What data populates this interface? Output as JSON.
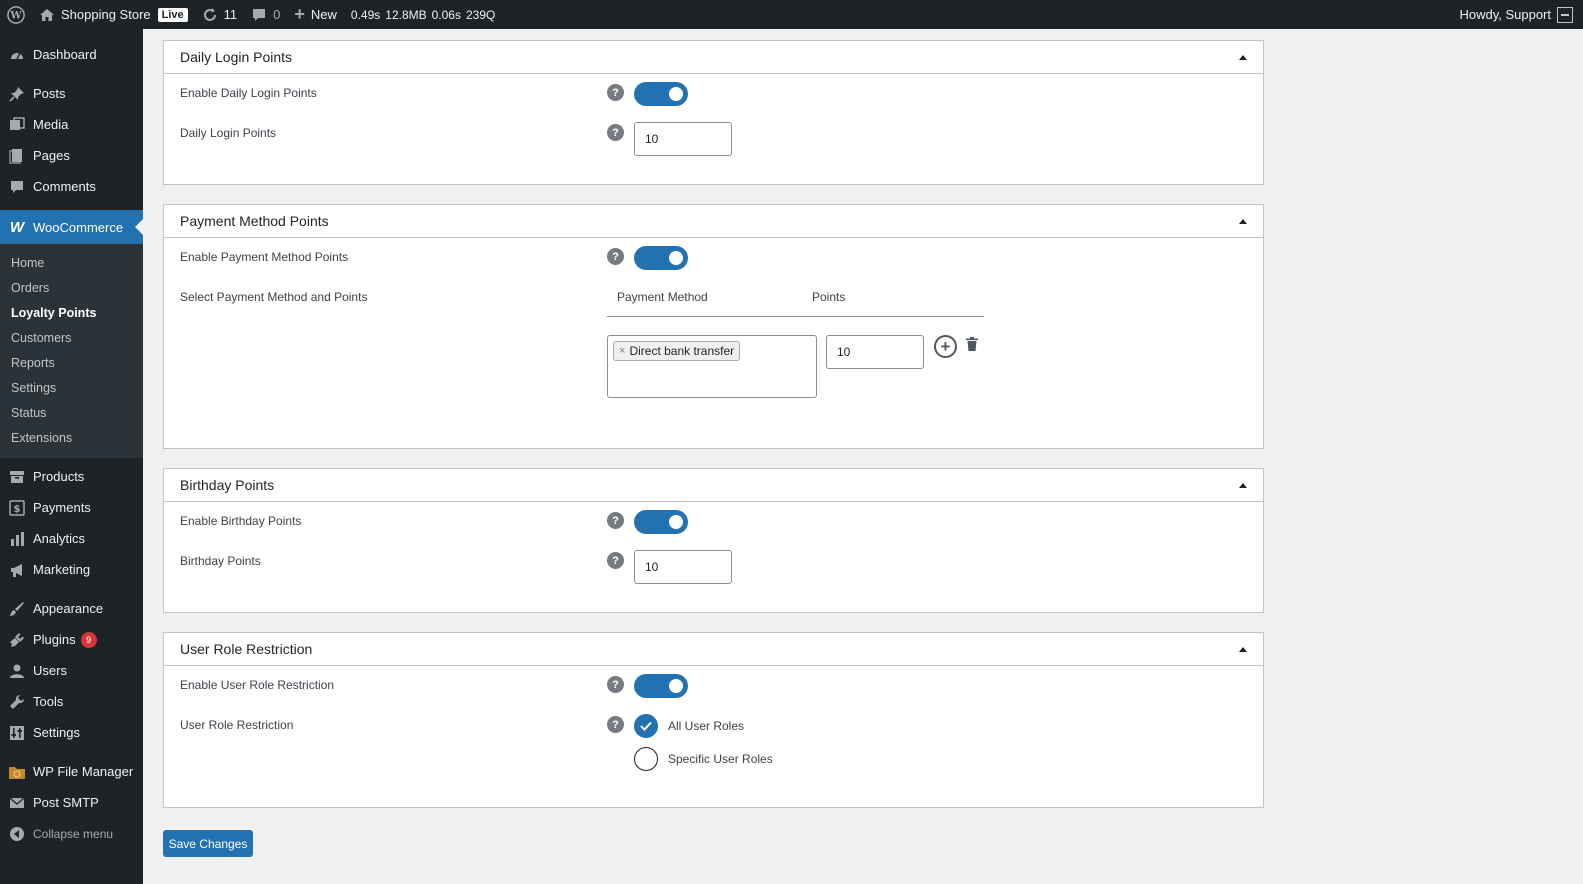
{
  "adminbar": {
    "site_name": "Shopping Store",
    "live_label": "Live",
    "updates_count": "11",
    "comments_count": "0",
    "new_label": "New",
    "perf_time": "0.49s",
    "perf_mem": "12.8MB",
    "perf_db": "0.06s",
    "perf_queries": "239Q",
    "howdy": "Howdy, Support"
  },
  "sidebar": {
    "dashboard": "Dashboard",
    "posts": "Posts",
    "media": "Media",
    "pages": "Pages",
    "comments": "Comments",
    "woocommerce": "WooCommerce",
    "woo_sub": [
      "Home",
      "Orders",
      "Loyalty Points",
      "Customers",
      "Reports",
      "Settings",
      "Status",
      "Extensions"
    ],
    "products": "Products",
    "payments": "Payments",
    "analytics": "Analytics",
    "marketing": "Marketing",
    "appearance": "Appearance",
    "plugins": "Plugins",
    "plugins_badge": "9",
    "users": "Users",
    "tools": "Tools",
    "settings": "Settings",
    "file_manager": "WP File Manager",
    "post_smtp": "Post SMTP",
    "collapse": "Collapse menu"
  },
  "panels": {
    "daily": {
      "title": "Daily Login Points",
      "enable_label": "Enable Daily Login Points",
      "points_label": "Daily Login Points",
      "points_value": "10"
    },
    "payment": {
      "title": "Payment Method Points",
      "enable_label": "Enable Payment Method Points",
      "select_label": "Select Payment Method and Points",
      "col_method": "Payment Method",
      "col_points": "Points",
      "chip_label": "Direct bank transfer",
      "chip_remove": "×",
      "points_value": "10"
    },
    "birthday": {
      "title": "Birthday Points",
      "enable_label": "Enable Birthday Points",
      "points_label": "Birthday Points",
      "points_value": "10"
    },
    "role": {
      "title": "User Role Restriction",
      "enable_label": "Enable User Role Restriction",
      "restriction_label": "User Role Restriction",
      "opt_all": "All User Roles",
      "opt_specific": "Specific User Roles"
    }
  },
  "save_label": "Save Changes",
  "colors": {
    "accent": "#2271b1",
    "adminbar": "#1d2327",
    "badge": "#d63638"
  }
}
